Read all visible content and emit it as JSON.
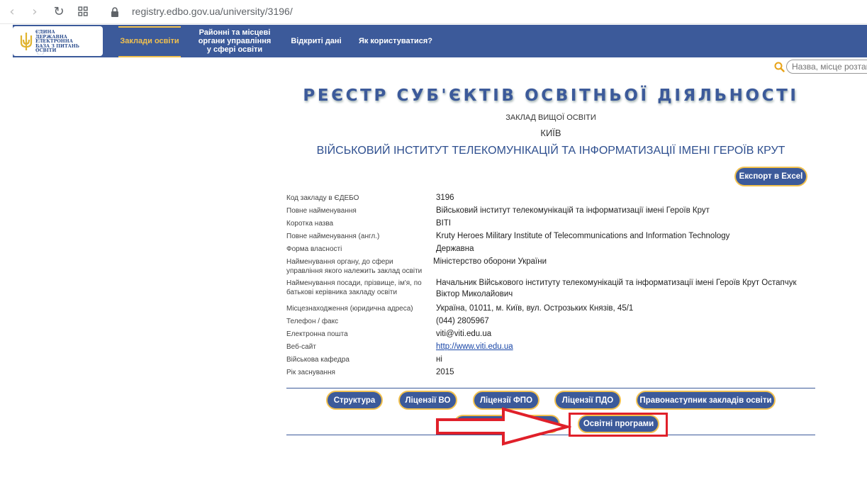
{
  "browser": {
    "url": "registry.edbo.gov.ua/university/3196/"
  },
  "logo": {
    "lines": [
      "ЄДИНА",
      "ДЕРЖАВНА",
      "ЕЛЕКТРОННА",
      "БАЗА З ПИТАНЬ",
      "ОСВІТИ"
    ]
  },
  "nav": {
    "item1": "Заклади освіти",
    "item2_l1": "Районні та місцеві",
    "item2_l2": "органи управління",
    "item2_l3": "у сфері освіти",
    "item3": "Відкриті дані",
    "item4": "Як користуватися?"
  },
  "search": {
    "placeholder": "Назва, місце розташування"
  },
  "page": {
    "title": "РЕЄСТР СУБ'ЄКТІВ ОСВІТНЬОЇ ДІЯЛЬНОСТІ",
    "subtitle": "ЗАКЛАД ВИЩОЇ ОСВІТИ",
    "city": "КИЇВ",
    "institution": "ВІЙСЬКОВИЙ ІНСТИТУТ ТЕЛЕКОМУНІКАЦІЙ ТА ІНФОРМАТИЗАЦІЇ ІМЕНІ ГЕРОЇВ КРУТ",
    "export_label": "Експорт в Excel"
  },
  "info": {
    "rows": [
      {
        "k": "Код закладу в ЄДЕБО",
        "v": "3196"
      },
      {
        "k": "Повне найменування",
        "v": "Військовий інститут телекомунікацій та інформатизації імені Героїв Крут"
      },
      {
        "k": "Коротка назва",
        "v": "ВІТІ"
      },
      {
        "k": "Повне найменування (англ.)",
        "v": "Kruty Heroes Military Institute of Telecommunications and Information Technology"
      },
      {
        "k": "Форма власності",
        "v": "Державна"
      },
      {
        "k": "Найменування органу, до сфери управління якого належить заклад освіти",
        "v": "Міністерство оборони України"
      },
      {
        "k": "Найменування посади, прізвище, ім'я, по батькові керівника закладу освіти",
        "v": "Начальник Військового інституту телекомунікацій та інформатизації імені Героїв Крут Остапчук Віктор Миколайович"
      },
      {
        "k": "Місцезнаходження (юридична адреса)",
        "v": "Україна, 01011, м. Київ, вул. Острозьких Князів, 45/1"
      },
      {
        "k": "Телефон / факс",
        "v": "(044) 2805967"
      },
      {
        "k": "Електронна пошта",
        "v": "viti@viti.edu.ua"
      },
      {
        "k": "Веб-сайт",
        "v": "http://www.viti.edu.ua"
      },
      {
        "k": "Військова кафедра",
        "v": "ні"
      },
      {
        "k": "Рік заснування",
        "v": "2015"
      }
    ]
  },
  "actions": {
    "structure": "Структура",
    "lic_vo": "Ліцензії ВО",
    "lic_fpo": "Ліцензії ФПО",
    "lic_pdo": "Ліцензії ПДО",
    "successor": "Правонаступник закладів освіти",
    "programs": "Освітні програми"
  },
  "colors": {
    "brand": "#3c5a9a",
    "accent": "#f2c14e",
    "annotation": "#e0202a"
  }
}
